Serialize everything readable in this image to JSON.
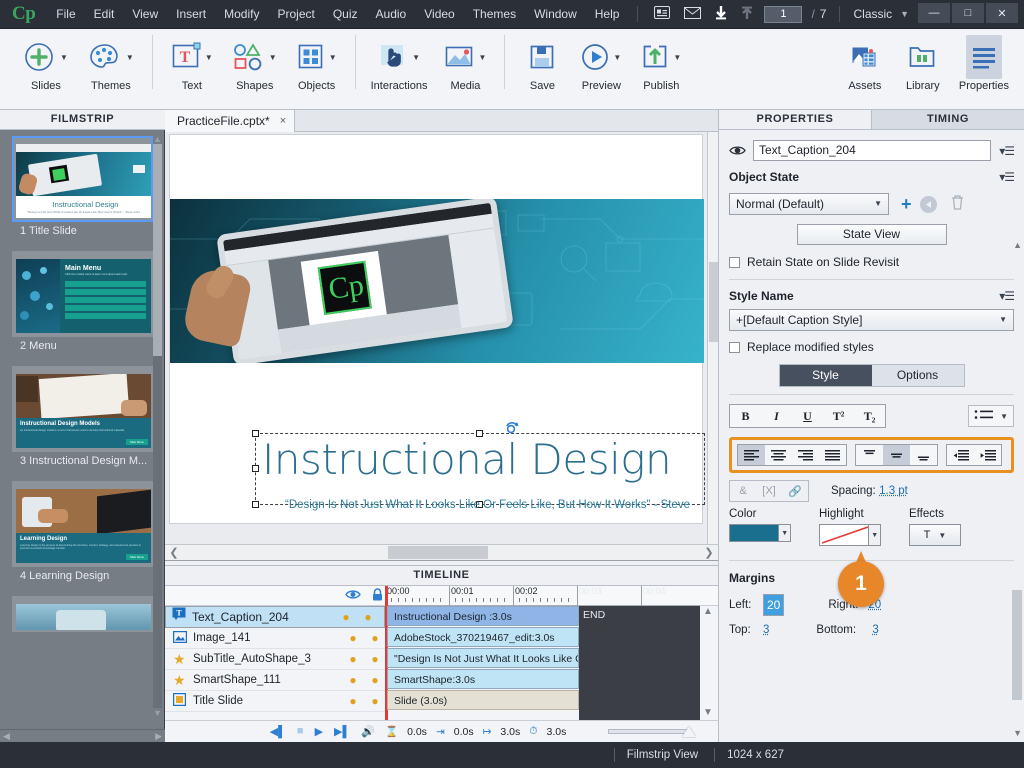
{
  "menubar": {
    "logo": "Cp",
    "items": [
      "File",
      "Edit",
      "View",
      "Insert",
      "Modify",
      "Project",
      "Quiz",
      "Audio",
      "Video",
      "Themes",
      "Window",
      "Help"
    ],
    "icons": [
      "slide-notes-icon",
      "mail-icon",
      "download-icon",
      "upload-icon"
    ],
    "page_current": "1",
    "page_separator": "/",
    "page_total": "7",
    "workspace": "Classic",
    "window_buttons": [
      "minimize",
      "maximize",
      "close"
    ]
  },
  "ribbon": {
    "groups": [
      {
        "items": [
          {
            "label": "Slides",
            "icon": "add-slide-icon",
            "dropdown": true
          },
          {
            "label": "Themes",
            "icon": "palette-icon",
            "dropdown": true
          }
        ]
      },
      {
        "items": [
          {
            "label": "Text",
            "icon": "text-caption-icon",
            "dropdown": true
          },
          {
            "label": "Shapes",
            "icon": "shapes-icon",
            "dropdown": true
          },
          {
            "label": "Objects",
            "icon": "objects-grid-icon",
            "dropdown": true
          }
        ]
      },
      {
        "items": [
          {
            "label": "Interactions",
            "icon": "hand-click-icon",
            "dropdown": true
          },
          {
            "label": "Media",
            "icon": "media-image-icon",
            "dropdown": true
          }
        ]
      },
      {
        "items": [
          {
            "label": "Save",
            "icon": "floppy-disk-icon",
            "dropdown": false
          },
          {
            "label": "Preview",
            "icon": "play-circle-icon",
            "dropdown": true
          },
          {
            "label": "Publish",
            "icon": "publish-upload-icon",
            "dropdown": true
          }
        ]
      },
      {
        "items": [
          {
            "label": "Assets",
            "icon": "assets-icon",
            "dropdown": false
          },
          {
            "label": "Library",
            "icon": "library-folder-icon",
            "dropdown": false
          },
          {
            "label": "Properties",
            "icon": "properties-lines-icon",
            "dropdown": false,
            "active": true
          }
        ]
      }
    ]
  },
  "filmstrip": {
    "title": "FILMSTRIP",
    "slides": [
      {
        "caption": "1 Title Slide",
        "selected": true,
        "heading": "Instructional Design",
        "sub": "\"Design Is Not Just What It Looks Like Or Feels Like, But How It Works\" - Steve Jobs"
      },
      {
        "caption": "2 Menu",
        "selected": false,
        "heading": "Main Menu",
        "sub": "Click the module name to learn more about each topic.",
        "menu_items": [
          "Instructional Design Models",
          "Learning Design",
          "Content",
          "Interactivity",
          "Assessment"
        ]
      },
      {
        "caption": "3 Instructional Design M...",
        "selected": false,
        "heading": "Instructional Design Models",
        "sub": "An instructional design model is a tool or framework used to develop instructional materials.",
        "button": "Main Menu"
      },
      {
        "caption": "4 Learning Design",
        "selected": false,
        "heading": "Learning Design",
        "sub": "Learning design is the process of determining the structure, content, strategy, and assessment process to promote successful knowledge transfer.",
        "button": "Main Menu"
      },
      {
        "caption": "",
        "selected": false,
        "heading": "",
        "sub": ""
      }
    ]
  },
  "document": {
    "tab_label": "PracticeFile.cptx*",
    "close_glyph": "×"
  },
  "slide": {
    "title": "Instructional Design",
    "subtitle": "“Design Is Not Just What It Looks Like Or Feels Like, But How It Works” - Steve",
    "selected_object": "Text_Caption_204"
  },
  "timeline": {
    "title": "TIMELINE",
    "header_icons": [
      "eye-icon",
      "lock-icon"
    ],
    "rows": [
      {
        "icon": "text-caption-icon",
        "name": "Text_Caption_204",
        "bar": "Instructional Design :3.0s",
        "selected": true
      },
      {
        "icon": "image-icon",
        "name": "Image_141",
        "bar": "AdobeStock_370219467_edit:3.0s",
        "selected": false
      },
      {
        "icon": "star-icon",
        "name": "SubTitle_AutoShape_3",
        "bar": "\"Design Is Not Just What It Looks Like Or F...",
        "selected": false
      },
      {
        "icon": "star-icon",
        "name": "SmartShape_111",
        "bar": "SmartShape:3.0s",
        "selected": false
      },
      {
        "icon": "slide-icon",
        "name": "Title Slide",
        "bar": "Slide (3.0s)",
        "selected": false
      }
    ],
    "ruler_labels": [
      "00:00",
      "00:01",
      "00:02",
      "00:03",
      "00:04"
    ],
    "end_label": "END",
    "playback_controls": [
      "rewind-icon",
      "stop-icon",
      "play-icon",
      "forward-icon",
      "audio-icon"
    ],
    "stats": [
      {
        "icon": "hourglass-icon",
        "value": "0.0s"
      },
      {
        "icon": "enter-icon",
        "value": "0.0s"
      },
      {
        "icon": "exit-icon",
        "value": "3.0s"
      },
      {
        "icon": "stopwatch-icon",
        "value": "3.0s"
      }
    ]
  },
  "properties": {
    "tabs": [
      {
        "label": "PROPERTIES",
        "active": true
      },
      {
        "label": "TIMING",
        "active": false
      }
    ],
    "object_name": "Text_Caption_204",
    "object_state": {
      "section_label": "Object State",
      "selected": "Normal (Default)",
      "state_view_button": "State View",
      "retain_checkbox": "Retain State on Slide Revisit"
    },
    "style": {
      "section_label": "Style Name",
      "selected": "+[Default Caption Style]",
      "replace_checkbox": "Replace modified styles",
      "segments": [
        {
          "label": "Style",
          "active": true
        },
        {
          "label": "Options",
          "active": false
        }
      ]
    },
    "format": {
      "buttons": [
        "B",
        "I",
        "U",
        "T²",
        "T₂"
      ],
      "bullets_icon": "bullet-list-icon",
      "align_icons": [
        "align-left-icon",
        "align-center-icon",
        "align-right-icon",
        "align-justify-icon"
      ],
      "align_active_index": 0,
      "valign_icons": [
        "valign-top-icon",
        "valign-middle-icon",
        "valign-bottom-icon"
      ],
      "valign_active_index": 1,
      "indent_icons": [
        "decrease-indent-icon",
        "increase-indent-icon"
      ],
      "highlight_color": "#e8872a"
    },
    "spacing": {
      "label": "Spacing:",
      "value": "1.3 pt",
      "small_buttons": [
        "insert-symbol-icon",
        "insert-variable-icon",
        "insert-link-icon"
      ]
    },
    "color_row": {
      "color_label": "Color",
      "color_value": "#1b6f8e",
      "highlight_label": "Highlight",
      "highlight_value": "none",
      "effects_label": "Effects",
      "effects_value": "T"
    },
    "margins": {
      "section_label": "Margins",
      "left_label": "Left:",
      "left_value": "20",
      "right_label": "Right:",
      "right_value": "20",
      "top_label": "Top:",
      "top_value": "3",
      "bottom_label": "Bottom:",
      "bottom_value": "3"
    }
  },
  "callout": {
    "number": "1",
    "color": "#e8872a"
  },
  "statusbar": {
    "view_mode": "Filmstrip View",
    "dimensions": "1024 x 627"
  }
}
